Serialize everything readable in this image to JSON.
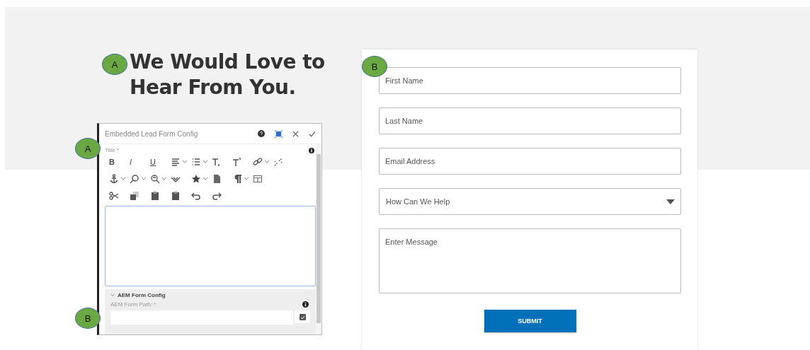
{
  "heading": "We Would Love to Hear From You.",
  "callouts": [
    {
      "label": "A"
    },
    {
      "label": "A"
    },
    {
      "label": "B"
    },
    {
      "label": "B"
    }
  ],
  "dialog": {
    "title": "Embedded Lead Form Config",
    "field_label": "Title *",
    "toolbar": [
      [
        {
          "kind": "bold",
          "label": "B",
          "dropdown": false
        },
        {
          "kind": "italic",
          "label": "I",
          "dropdown": false
        },
        {
          "kind": "underline",
          "label": "U",
          "dropdown": false
        },
        {
          "kind": "align",
          "dropdown": true
        },
        {
          "kind": "list",
          "dropdown": true
        },
        {
          "kind": "subscript",
          "dropdown": false
        },
        {
          "kind": "superscript",
          "dropdown": false
        },
        {
          "kind": "link",
          "dropdown": true
        },
        {
          "kind": "unlink",
          "dropdown": false
        }
      ],
      [
        {
          "kind": "anchor",
          "dropdown": true
        },
        {
          "kind": "search",
          "dropdown": true
        },
        {
          "kind": "replace",
          "dropdown": true
        },
        {
          "kind": "spellcheck",
          "dropdown": false
        },
        {
          "kind": "star",
          "dropdown": true
        },
        {
          "kind": "document",
          "dropdown": false
        },
        {
          "kind": "paragraph",
          "dropdown": true
        },
        {
          "kind": "table",
          "dropdown": false
        }
      ],
      [
        {
          "kind": "cut",
          "dropdown": false
        },
        {
          "kind": "copy",
          "dropdown": false
        },
        {
          "kind": "paste",
          "dropdown": false
        },
        {
          "kind": "paste",
          "dropdown": false
        },
        {
          "kind": "undo",
          "dropdown": false
        },
        {
          "kind": "redo",
          "dropdown": false
        }
      ]
    ],
    "section": {
      "title": "AEM Form Config",
      "expanded": true,
      "field_label": "AEM Form Path: *"
    }
  },
  "form": {
    "fields": [
      {
        "kind": "text",
        "placeholder": "First Name"
      },
      {
        "kind": "text",
        "placeholder": "Last Name"
      },
      {
        "kind": "text",
        "placeholder": "Email Address"
      },
      {
        "kind": "select",
        "placeholder": "How Can We Help"
      },
      {
        "kind": "textarea",
        "placeholder": "Enter Message"
      }
    ],
    "submit": "SUBMIT"
  }
}
